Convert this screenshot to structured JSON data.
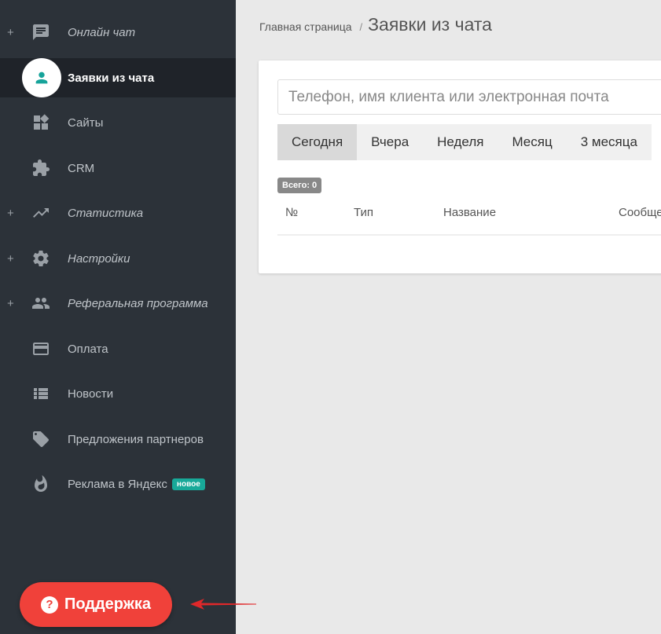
{
  "sidebar": {
    "items": [
      {
        "label": "Онлайн чат",
        "icon": "chat-icon",
        "plus": "+"
      },
      {
        "label": "Заявки из чата",
        "icon": "person-icon"
      },
      {
        "label": "Сайты",
        "icon": "widgets-icon"
      },
      {
        "label": "CRM",
        "icon": "puzzle-icon"
      },
      {
        "label": "Статистика",
        "icon": "trending-up-icon",
        "plus": "+"
      },
      {
        "label": "Настройки",
        "icon": "gear-icon",
        "plus": "+"
      },
      {
        "label": "Реферальная программа",
        "icon": "people-icon",
        "plus": "+"
      },
      {
        "label": "Оплата",
        "icon": "credit-card-icon"
      },
      {
        "label": "Новости",
        "icon": "list-icon"
      },
      {
        "label": "Предложения партнеров",
        "icon": "tag-icon"
      },
      {
        "label": "Реклама в Яндекс",
        "icon": "fire-icon",
        "badge": "новое"
      }
    ],
    "support": {
      "label": "Поддержка",
      "icon_char": "?"
    }
  },
  "breadcrumb": {
    "home": "Главная страница",
    "separator": "/",
    "title": "Заявки из чата"
  },
  "search": {
    "placeholder": "Телефон, имя клиента или электронная почта"
  },
  "tabs": [
    "Сегодня",
    "Вчера",
    "Неделя",
    "Месяц",
    "3 месяца"
  ],
  "total_badge": "Всего: 0",
  "table": {
    "headers": [
      "№",
      "Тип",
      "Название",
      "Сообщение"
    ]
  },
  "colors": {
    "sidebar": "#2c3239",
    "accent": "#16a39a",
    "support": "#f0413a"
  }
}
